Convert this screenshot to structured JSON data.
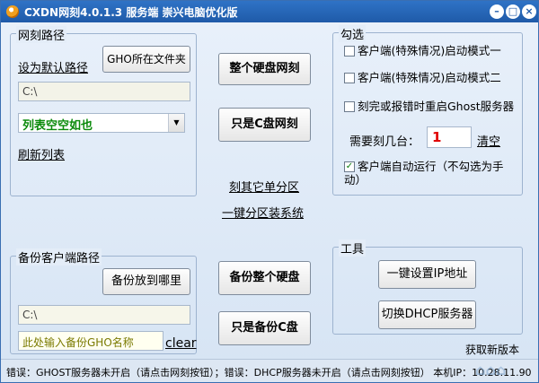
{
  "window": {
    "title": "CXDN网刻4.0.1.3 服务端 崇兴电脑优化版",
    "min_glyph": "–",
    "max_glyph": "□",
    "close_glyph": "×"
  },
  "netclone_path": {
    "group_label": "网刻路径",
    "set_default_link": "设为默认路径",
    "gho_folder_button": "GHO所在文件夹",
    "path_value": "C:\\",
    "list_select_value": "列表空空如也",
    "refresh_link": "刷新列表"
  },
  "center_top": {
    "whole_disk_button": "整个硬盘网刻",
    "c_only_button": "只是C盘网刻",
    "other_partitions_link": "刻其它单分区",
    "partition_install_link": "一键分区装系统"
  },
  "options": {
    "group_label": "勾选",
    "client_mode1": "客户端(特殊情况)启动模式一",
    "client_mode2": "客户端(特殊情况)启动模式二",
    "restart_ghost": "刻完或报错时重启Ghost服务器",
    "count_label": "需要刻几台：",
    "count_value": "1",
    "clear_link": "清空",
    "auto_run_label": "客户端自动运行（不勾选为手动）",
    "auto_run_checked": true,
    "check_glyph": "✓"
  },
  "backup": {
    "group_label": "备份客户端路径",
    "backup_where_button": "备份放到哪里",
    "path_value": "C:\\",
    "name_placeholder": "此处输入备份GHO名称",
    "clear_link": "clear"
  },
  "center_bottom": {
    "backup_whole_button": "备份整个硬盘",
    "backup_c_button": "只是备份C盘"
  },
  "tools": {
    "group_label": "工具",
    "set_ip_button": "一键设置IP地址",
    "switch_dhcp_button": "切换DHCP服务器",
    "latest_version_link": "获取新版本"
  },
  "status": {
    "text": "错误：GHOST服务器未开启（请点击网刻按钮）；错误：DHCP服务器未开启（请点击网刻按钮） 本机IP：10.28.11.90"
  },
  "colors": {
    "title_bar": "#1f5aa8",
    "count_red": "#e00000",
    "list_green": "#0a8a0a"
  }
}
